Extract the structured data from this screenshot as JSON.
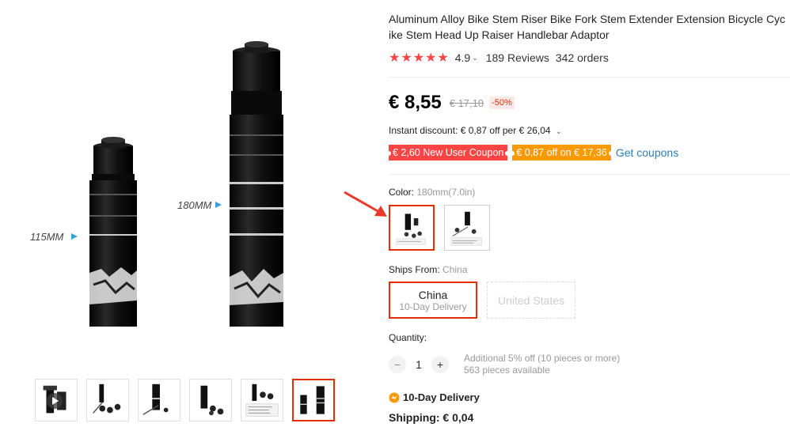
{
  "product": {
    "title": "Aluminum Alloy Bike Stem Riser Bike Fork Stem Extender Extension Bicycle Cycle Bike Stem Head Up Raiser Handlebar Adaptor",
    "title_display": "Aluminum Alloy Bike Stem Riser Bike Fork Stem Extender Extension Bicycle Cyc\nike Stem Head Up Raiser Handlebar Adaptor"
  },
  "gallery": {
    "labels": {
      "short": "115MM",
      "tall": "180MM"
    },
    "thumbnail_count": 6,
    "active_thumbnail": 6
  },
  "rating": {
    "stars": "★★★★★",
    "value": "4.9",
    "reviews": "189 Reviews",
    "orders": "342 orders"
  },
  "price": {
    "current": "€ 8,55",
    "original": "€ 17,10",
    "discount": "-50%"
  },
  "instant_discount": "Instant discount: € 0,87 off per € 26,04",
  "coupons": {
    "new_user": "€ 2,60 New User Coupon",
    "store": "€ 0,87 off on € 17,36",
    "get_coupons": "Get coupons"
  },
  "color": {
    "label": "Color:",
    "selected": "180mm(7.0in)",
    "options": [
      "180mm",
      "115mm"
    ]
  },
  "ships_from": {
    "label": "Ships From:",
    "selected": "China",
    "options": [
      {
        "name": "China",
        "sub": "10-Day Delivery"
      },
      {
        "name": "United States"
      }
    ]
  },
  "quantity": {
    "label": "Quantity:",
    "value": "1",
    "minus": "−",
    "plus": "+",
    "note": "Additional 5% off (10 pieces or more)",
    "available": "563 pieces available"
  },
  "delivery": "10-Day Delivery",
  "shipping": "Shipping: € 0,04",
  "colors": {
    "accent": "#e62e04",
    "star": "#ff4444",
    "coupon_red": "#ff4444",
    "coupon_orange": "#ff9900",
    "link": "#2e7cb8"
  }
}
